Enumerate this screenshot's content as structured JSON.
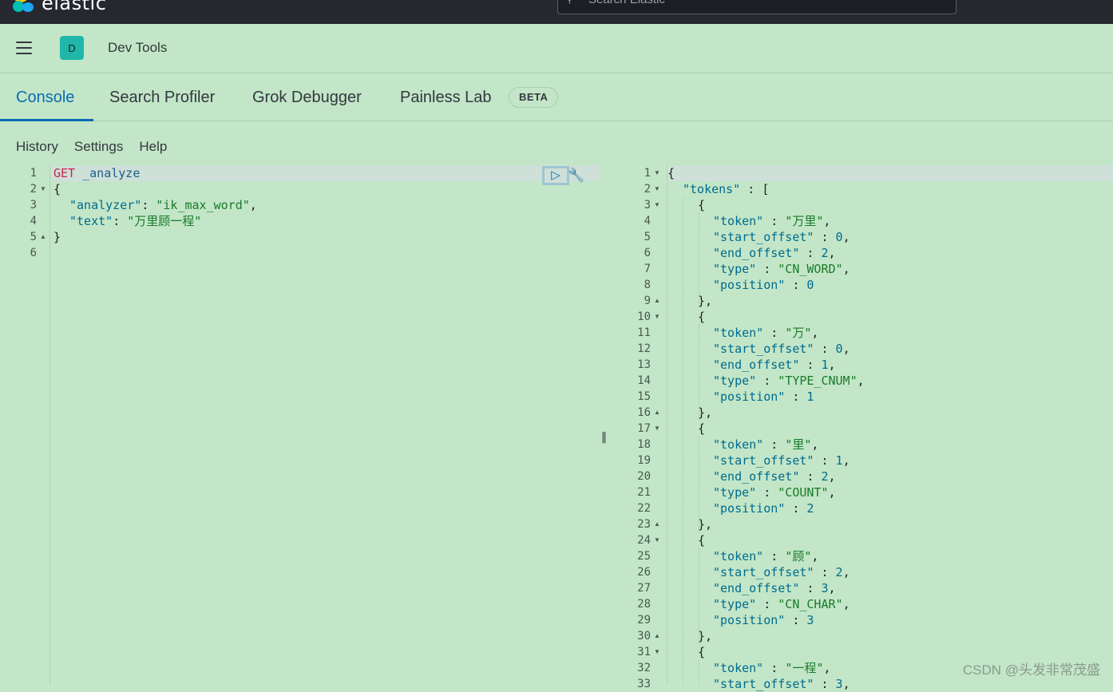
{
  "topbar": {
    "logo_text": "elastic",
    "search_placeholder": "Search Elastic",
    "colors": {
      "bg": "#25282f",
      "logo_yellow": "#fec514",
      "logo_teal": "#00bfb3",
      "logo_blue": "#1ba9f5"
    }
  },
  "header": {
    "space_initial": "D",
    "breadcrumb": "Dev Tools"
  },
  "tabs": [
    {
      "label": "Console",
      "active": true
    },
    {
      "label": "Search Profiler",
      "active": false
    },
    {
      "label": "Grok Debugger",
      "active": false
    },
    {
      "label": "Painless Lab",
      "active": false
    }
  ],
  "beta_badge": "BETA",
  "submenu": [
    "History",
    "Settings",
    "Help"
  ],
  "request": {
    "line_numbers": [
      "1",
      "2",
      "3",
      "4",
      "5",
      "6"
    ],
    "method": "GET",
    "path": " _analyze",
    "l2": "{",
    "l3_key": "\"analyzer\"",
    "l3_colon": ": ",
    "l3_val": "\"ik_max_word\"",
    "l3_comma": ",",
    "l4_key": "\"text\"",
    "l4_colon": ": ",
    "l4_val": "\"万里顾一程\"",
    "l5": "}"
  },
  "response": {
    "line_numbers": [
      "1",
      "2",
      "3",
      "4",
      "5",
      "6",
      "7",
      "8",
      "9",
      "10",
      "11",
      "12",
      "13",
      "14",
      "15",
      "16",
      "17",
      "18",
      "19",
      "20",
      "21",
      "22",
      "23",
      "24",
      "25",
      "26",
      "27",
      "28",
      "29",
      "30",
      "31",
      "32",
      "33"
    ],
    "tokens_key": "\"tokens\"",
    "tokens_sep": " : [",
    "open_brace": "{",
    "close_brace_comma": "},",
    "token_entries": [
      {
        "token": "\"万里\"",
        "start_offset": "0",
        "end_offset": "2",
        "type": "\"CN_WORD\"",
        "position": "0"
      },
      {
        "token": "\"万\"",
        "start_offset": "0",
        "end_offset": "1",
        "type": "\"TYPE_CNUM\"",
        "position": "1"
      },
      {
        "token": "\"里\"",
        "start_offset": "1",
        "end_offset": "2",
        "type": "\"COUNT\"",
        "position": "2"
      },
      {
        "token": "\"顾\"",
        "start_offset": "2",
        "end_offset": "3",
        "type": "\"CN_CHAR\"",
        "position": "3"
      },
      {
        "token": "\"一程\"",
        "start_offset": "3",
        "end_offset": "",
        "type": "",
        "position": ""
      }
    ],
    "field_keys": {
      "token": "\"token\"",
      "start_offset": "\"start_offset\"",
      "end_offset": "\"end_offset\"",
      "type": "\"type\"",
      "position": "\"position\""
    }
  },
  "resizer_glyph": "‖",
  "watermark": "CSDN @头发非常茂盛"
}
